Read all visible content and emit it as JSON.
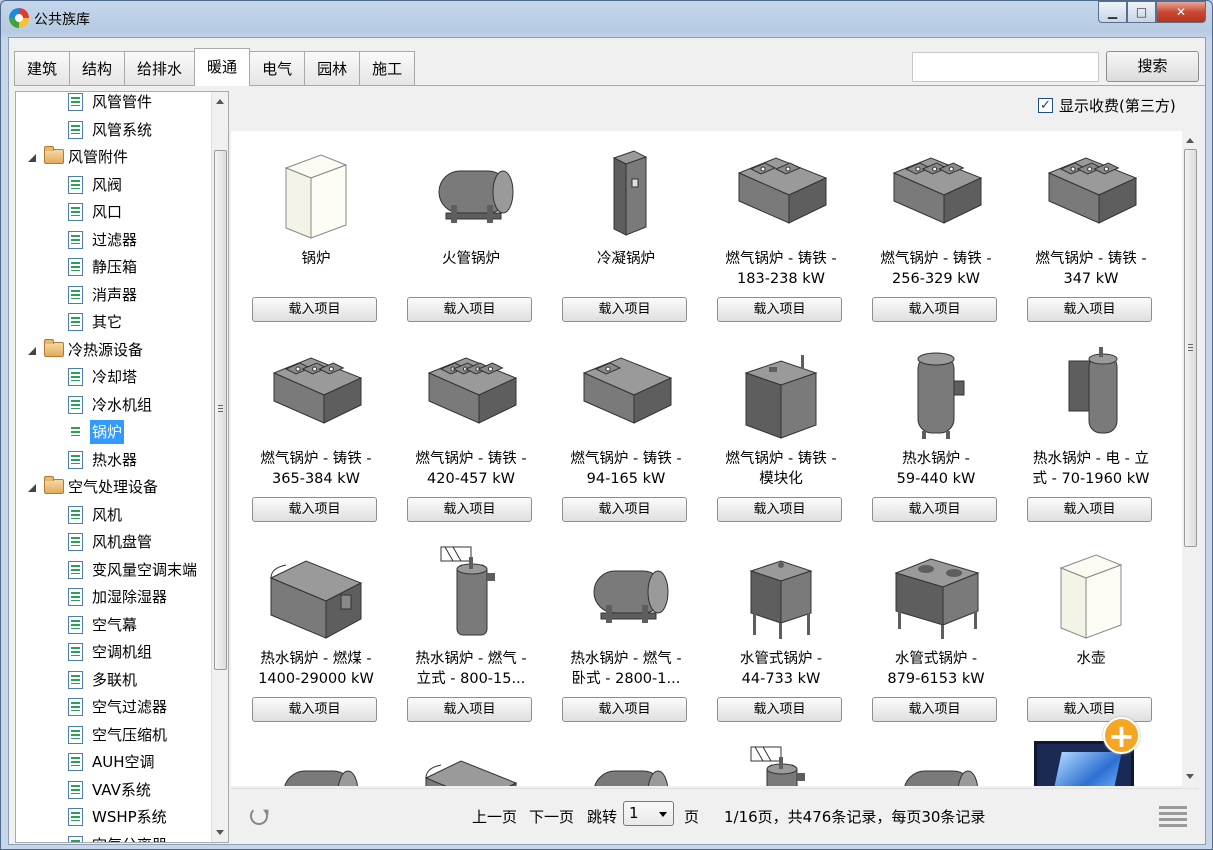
{
  "window": {
    "title": "公共族库",
    "minimize": "▁",
    "maximize": "□",
    "close": "✕"
  },
  "tabs": [
    {
      "label": "建筑",
      "active": false
    },
    {
      "label": "结构",
      "active": false
    },
    {
      "label": "给排水",
      "active": false
    },
    {
      "label": "暖通",
      "active": true
    },
    {
      "label": "电气",
      "active": false
    },
    {
      "label": "园林",
      "active": false
    },
    {
      "label": "施工",
      "active": false
    }
  ],
  "search": {
    "value": "",
    "button_label": "搜索"
  },
  "show_paid": {
    "checked": true,
    "label": "显示收费(第三方)"
  },
  "tree": [
    {
      "label": "风管管件",
      "type": "file",
      "level": 1
    },
    {
      "label": "风管系统",
      "type": "file",
      "level": 1
    },
    {
      "label": "风管附件",
      "type": "folder",
      "level": 0
    },
    {
      "label": "风阀",
      "type": "file",
      "level": 1
    },
    {
      "label": "风口",
      "type": "file",
      "level": 1
    },
    {
      "label": "过滤器",
      "type": "file",
      "level": 1
    },
    {
      "label": "静压箱",
      "type": "file",
      "level": 1
    },
    {
      "label": "消声器",
      "type": "file",
      "level": 1
    },
    {
      "label": "其它",
      "type": "file",
      "level": 1
    },
    {
      "label": "冷热源设备",
      "type": "folder",
      "level": 0
    },
    {
      "label": "冷却塔",
      "type": "file",
      "level": 1
    },
    {
      "label": "冷水机组",
      "type": "file",
      "level": 1
    },
    {
      "label": "锅炉",
      "type": "file",
      "level": 1,
      "selected": true
    },
    {
      "label": "热水器",
      "type": "file",
      "level": 1
    },
    {
      "label": "空气处理设备",
      "type": "folder",
      "level": 0
    },
    {
      "label": "风机",
      "type": "file",
      "level": 1
    },
    {
      "label": "风机盘管",
      "type": "file",
      "level": 1
    },
    {
      "label": "变风量空调末端",
      "type": "file",
      "level": 1
    },
    {
      "label": "加湿除湿器",
      "type": "file",
      "level": 1
    },
    {
      "label": "空气幕",
      "type": "file",
      "level": 1
    },
    {
      "label": "空调机组",
      "type": "file",
      "level": 1
    },
    {
      "label": "多联机",
      "type": "file",
      "level": 1
    },
    {
      "label": "空气过滤器",
      "type": "file",
      "level": 1
    },
    {
      "label": "空气压缩机",
      "type": "file",
      "level": 1
    },
    {
      "label": "AUH空调",
      "type": "file",
      "level": 1
    },
    {
      "label": "VAV系统",
      "type": "file",
      "level": 1
    },
    {
      "label": "WSHP系统",
      "type": "file",
      "level": 1
    },
    {
      "label": "空气分离器",
      "type": "file",
      "level": 1
    }
  ],
  "load_label": "载入项目",
  "items": [
    {
      "name": [
        "锅炉"
      ],
      "thumb": "box-white"
    },
    {
      "name": [
        "火管锅炉"
      ],
      "thumb": "tank-horizontal"
    },
    {
      "name": [
        "冷凝锅炉"
      ],
      "thumb": "cabinet"
    },
    {
      "name": [
        "燃气锅炉 - 铸铁 -",
        "183-238 kW"
      ],
      "thumb": "sectional-2"
    },
    {
      "name": [
        "燃气锅炉 - 铸铁 -",
        "256-329 kW"
      ],
      "thumb": "sectional-3"
    },
    {
      "name": [
        "燃气锅炉 - 铸铁 -",
        "347 kW"
      ],
      "thumb": "sectional-3"
    },
    {
      "name": [
        "燃气锅炉 - 铸铁 -",
        "365-384 kW"
      ],
      "thumb": "sectional-3"
    },
    {
      "name": [
        "燃气锅炉 - 铸铁 -",
        "420-457 kW"
      ],
      "thumb": "sectional-4"
    },
    {
      "name": [
        "燃气锅炉 - 铸铁 -",
        "94-165 kW"
      ],
      "thumb": "sectional-1"
    },
    {
      "name": [
        "燃气锅炉 - 铸铁 -",
        "模块化"
      ],
      "thumb": "box-grey"
    },
    {
      "name": [
        "热水锅炉 -",
        "59-440 kW"
      ],
      "thumb": "tank-vertical"
    },
    {
      "name": [
        "热水锅炉 - 电 - 立",
        "式 - 70-1960 kW"
      ],
      "thumb": "tank-vertical-2"
    },
    {
      "name": [
        "热水锅炉 - 燃煤 -",
        "1400-29000 kW"
      ],
      "thumb": "long-box"
    },
    {
      "name": [
        "热水锅炉 - 燃气 -",
        "立式 - 800-15..."
      ],
      "thumb": "cylinder-vertical"
    },
    {
      "name": [
        "热水锅炉 - 燃气 -",
        "卧式 - 2800-1..."
      ],
      "thumb": "tank-horizontal"
    },
    {
      "name": [
        "水管式锅炉 -",
        "44-733 kW"
      ],
      "thumb": "legged-box"
    },
    {
      "name": [
        "水管式锅炉 -",
        "879-6153 kW"
      ],
      "thumb": "legged-box-wide"
    },
    {
      "name": [
        "水壶"
      ],
      "thumb": "box-white"
    }
  ],
  "pager": {
    "prev": "上一页",
    "next": "下一页",
    "jump": "跳转",
    "page_value": "1",
    "page_unit": "页",
    "summary": "1/16页，共476条记录，每页30条记录"
  },
  "fab_label": "+"
}
